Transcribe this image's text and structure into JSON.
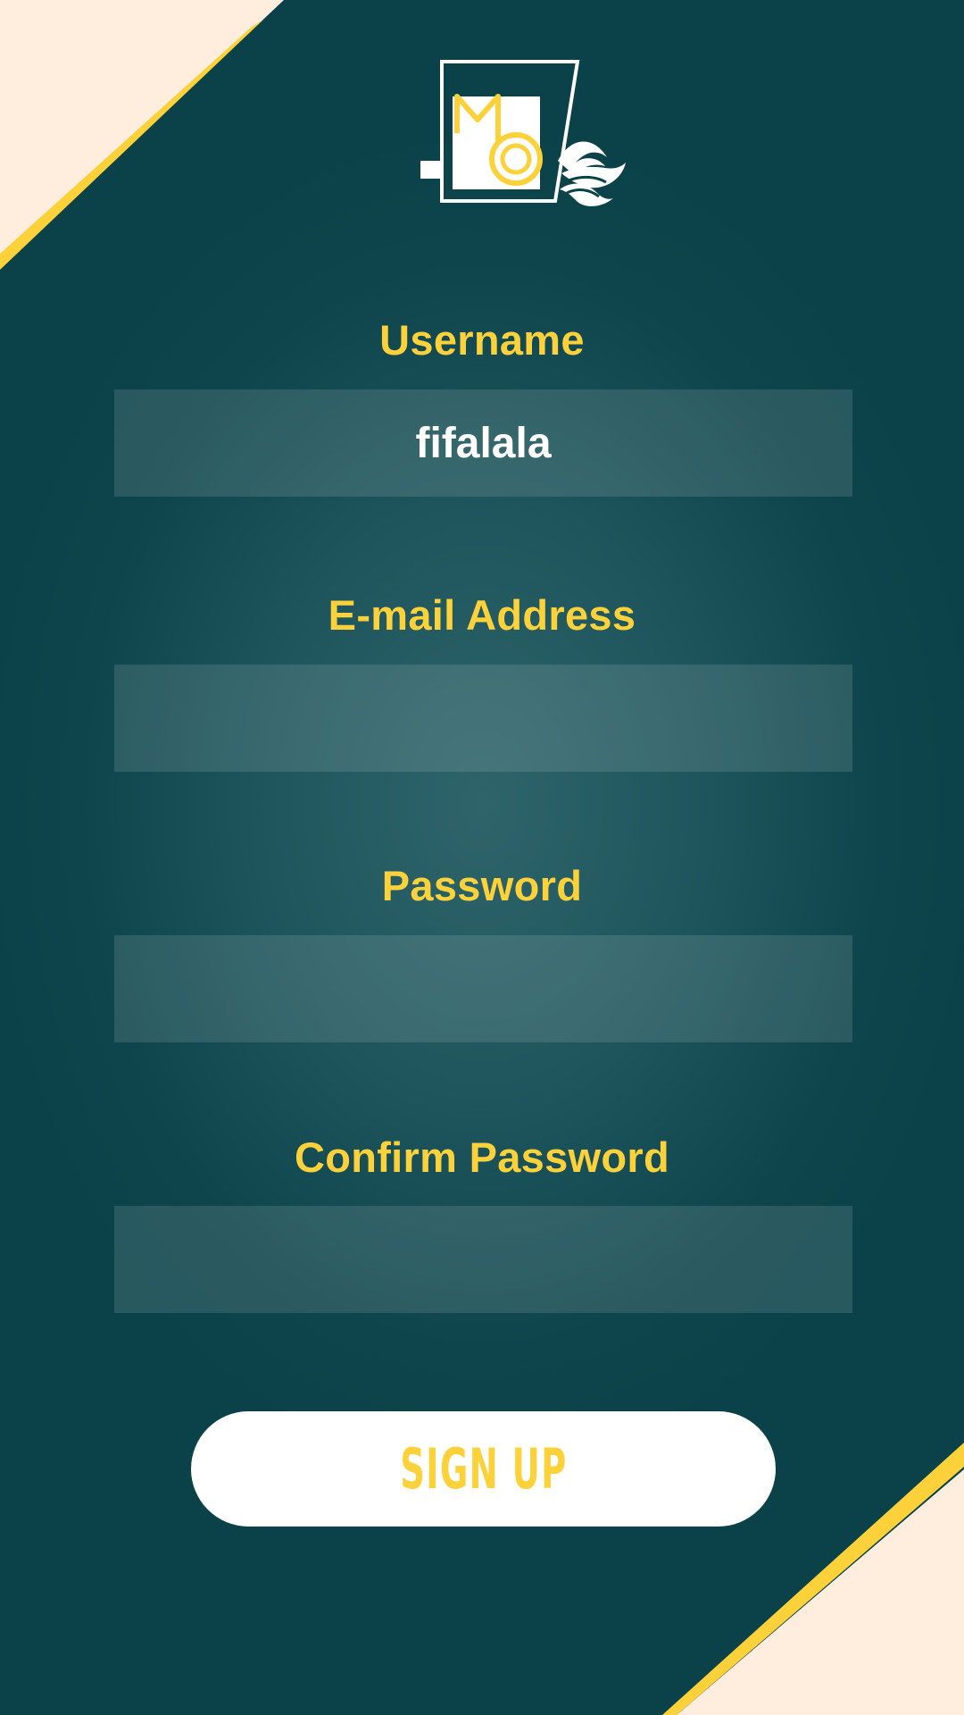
{
  "colors": {
    "background": "#0b4249",
    "accent_yellow": "#fdd13a",
    "corner_cream": "#ffeedd",
    "input_fill": "rgba(255,255,255,0.12)",
    "button_fill": "#ffffff"
  },
  "logo": {
    "icon": "hotel-door-key-logo"
  },
  "form": {
    "username": {
      "label": "Username",
      "value": "fifalala",
      "placeholder": ""
    },
    "email": {
      "label": "E-mail Address",
      "value": "",
      "placeholder": ""
    },
    "password": {
      "label": "Password",
      "value": "",
      "placeholder": ""
    },
    "confirm_password": {
      "label": "Confirm Password",
      "value": "",
      "placeholder": ""
    }
  },
  "actions": {
    "signup_label": "SIGN UP"
  }
}
